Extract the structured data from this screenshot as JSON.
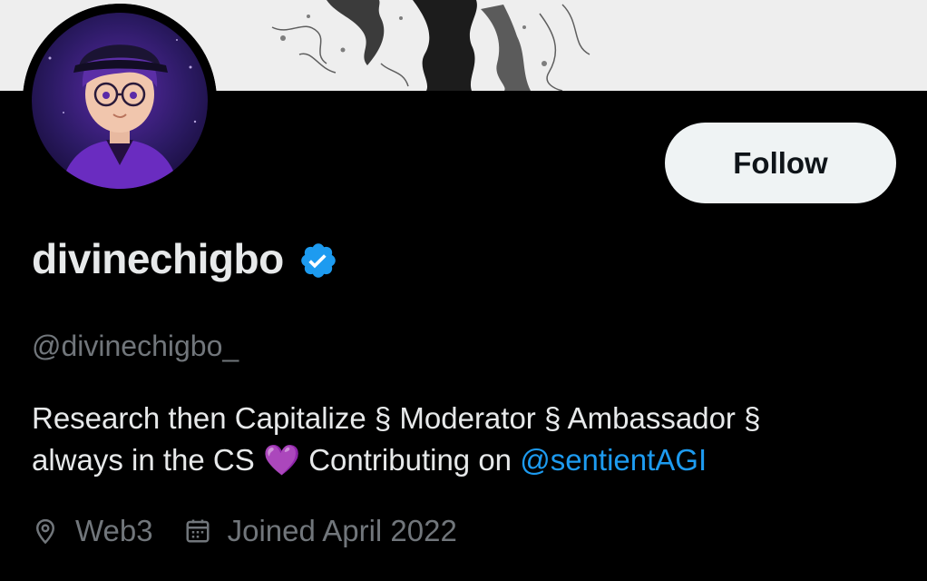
{
  "profile": {
    "display_name": "divinechigbo",
    "handle": "@divinechigbo_",
    "verified": true,
    "bio_line1": "Research then Capitalize § Moderator § Ambassador §",
    "bio_line2_prefix": "always in the CS ",
    "bio_emoji": "💜",
    "bio_line2_middle": " Contributing on ",
    "bio_mention": "@sentientAGI",
    "location": "Web3",
    "joined": "Joined April 2022"
  },
  "actions": {
    "follow_label": "Follow"
  },
  "icons": {
    "verified": "verified-badge-icon",
    "location": "location-pin-icon",
    "joined": "calendar-icon"
  },
  "colors": {
    "background": "#000000",
    "text_primary": "#e7e9ea",
    "text_secondary": "#71767b",
    "accent": "#1d9bf0",
    "follow_bg": "#eff3f4"
  }
}
